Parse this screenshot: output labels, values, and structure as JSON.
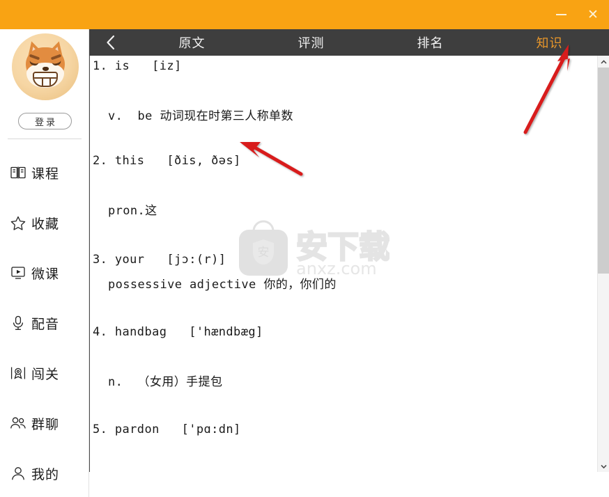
{
  "window": {
    "titlebar_color": "#f9a313",
    "minimize_label": "–",
    "close_label": "✕"
  },
  "sidebar": {
    "avatar_name": "user-avatar-shiba",
    "login_label": "登录",
    "items": [
      {
        "icon": "book-icon",
        "label": "课程"
      },
      {
        "icon": "star-icon",
        "label": "收藏"
      },
      {
        "icon": "video-icon",
        "label": "微课"
      },
      {
        "icon": "microphone-icon",
        "label": "配音"
      },
      {
        "icon": "medal-icon",
        "label": "闯关"
      },
      {
        "icon": "group-icon",
        "label": "群聊"
      },
      {
        "icon": "person-icon",
        "label": "我的"
      }
    ]
  },
  "tabbar": {
    "back_icon": "chevron-left-icon",
    "active_color": "#e8962a",
    "background": "#3e3e3e",
    "tabs": [
      {
        "label": "原文",
        "active": false
      },
      {
        "label": "评测",
        "active": false
      },
      {
        "label": "排名",
        "active": false
      },
      {
        "label": "知识",
        "active": true
      }
    ]
  },
  "content": {
    "entries": [
      {
        "index": "1.",
        "word": "is",
        "phonetic": "[iz]",
        "head": "1. is   [iz]",
        "definition": "v.  be 动词现在时第三人称单数"
      },
      {
        "index": "2.",
        "word": "this",
        "phonetic": "[ðis, ðəs]",
        "head": "2. this   [ðis, ðəs]",
        "definition": "pron.这"
      },
      {
        "index": "3.",
        "word": "your",
        "phonetic": "[jɔ:(r)]",
        "head": "3. your   [jɔ:(r)]",
        "definition": "possessive adjective 你的，你们的"
      },
      {
        "index": "4.",
        "word": "handbag",
        "phonetic": "['hændbæg]",
        "head": "4. handbag   ['hændbæg]",
        "definition": "n.  （女用）手提包"
      },
      {
        "index": "5.",
        "word": "pardon",
        "phonetic": "['pɑ:dn]",
        "head": "5. pardon   ['pɑ:dn]",
        "definition": ""
      }
    ]
  },
  "watermark": {
    "logo_text": "安",
    "brand": "安下载",
    "site": "anxz.com",
    "color": "#c9c9c9"
  },
  "scrollbar": {
    "up_icon": "chevron-up-icon",
    "down_icon": "chevron-down-icon",
    "thumb_name": "scrollbar-thumb"
  },
  "annotations": {
    "arrow_color": "#d81f1f",
    "arrows": [
      {
        "name": "arrow-to-knowledge-tab"
      },
      {
        "name": "arrow-to-this-entry"
      }
    ]
  }
}
